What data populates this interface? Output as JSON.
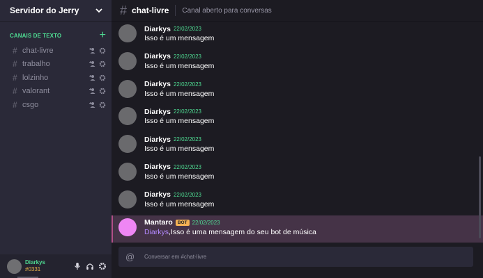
{
  "server": {
    "name": "Servidor do Jerry",
    "menu_icon": "chevron-down-icon"
  },
  "sidebar": {
    "section_title": "CANAIS DE TEXTO",
    "add_icon": "plus-icon",
    "channels": [
      {
        "name": "chat-livre"
      },
      {
        "name": "trabalho"
      },
      {
        "name": "lolzinho"
      },
      {
        "name": "valorant"
      },
      {
        "name": "csgo"
      }
    ]
  },
  "user": {
    "name": "Diarkys",
    "tag": "#0331"
  },
  "channel": {
    "name": "chat-livre",
    "topic": "Canal aberto para conversas"
  },
  "messages": [
    {
      "author": "Diarkys",
      "date": "22/02/2023",
      "text": "Isso é um mensagem"
    },
    {
      "author": "Diarkys",
      "date": "22/02/2023",
      "text": "Isso é um mensagem"
    },
    {
      "author": "Diarkys",
      "date": "22/02/2023",
      "text": "Isso é um mensagem"
    },
    {
      "author": "Diarkys",
      "date": "22/02/2023",
      "text": "Isso é um mensagem"
    },
    {
      "author": "Diarkys",
      "date": "22/02/2023",
      "text": "Isso é um mensagem"
    },
    {
      "author": "Diarkys",
      "date": "22/02/2023",
      "text": "Isso é um mensagem"
    },
    {
      "author": "Diarkys",
      "date": "22/02/2023",
      "text": "Isso é um mensagem"
    },
    {
      "author": "Mantaro",
      "badge": "BOT",
      "date": "22/02/2023",
      "mention": "Diarkys",
      "text": ",Isso é uma mensagem do seu bot de música"
    }
  ],
  "composer": {
    "placeholder": "Conversar em #chat-livre",
    "value": ""
  },
  "colors": {
    "accent": "#4fdc93",
    "bot_highlight": "#453347",
    "bot_badge": "#f5b255",
    "mention": "#b489ff"
  }
}
